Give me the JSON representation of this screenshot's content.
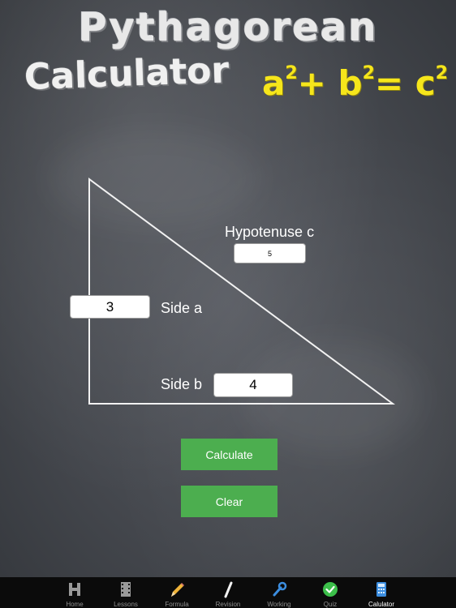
{
  "header": {
    "title_line1": "Pythagorean",
    "title_line2": "Calculator",
    "formula": {
      "a": "a",
      "plus": "+ ",
      "b": "b",
      "equals": "= ",
      "c": "c",
      "exponent": "2"
    }
  },
  "calculator": {
    "hypotenuse_label": "Hypotenuse c",
    "hypotenuse_value": "5",
    "side_a_label": "Side a",
    "side_a_value": "3",
    "side_b_label": "Side b",
    "side_b_value": "4",
    "calculate_label": "Calculate",
    "clear_label": "Clear"
  },
  "colors": {
    "button_green": "#4cae4f",
    "formula_yellow": "#f6e61b",
    "chalkboard": "#45484e",
    "tabbar": "#0b0b0b"
  },
  "tabs": [
    {
      "label": "Home",
      "icon": "home-h-icon",
      "active": false
    },
    {
      "label": "Lessons",
      "icon": "film-strip-icon",
      "active": false
    },
    {
      "label": "Formula",
      "icon": "pencil-icon",
      "active": false
    },
    {
      "label": "Revision",
      "icon": "chalk-icon",
      "active": false
    },
    {
      "label": "Working",
      "icon": "wrench-icon",
      "active": false
    },
    {
      "label": "Quiz",
      "icon": "checkmark-icon",
      "active": false
    },
    {
      "label": "Calulator",
      "icon": "calculator-icon",
      "active": true
    }
  ]
}
